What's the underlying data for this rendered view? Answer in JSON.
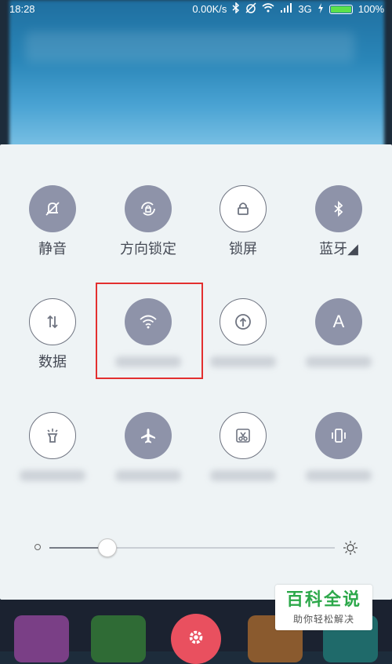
{
  "status_bar": {
    "time": "18:28",
    "net_speed": "0.00K/s",
    "network_type": "3G",
    "battery": "100%",
    "icons": [
      "bluetooth-icon",
      "alarm-off-icon",
      "wifi-icon",
      "signal-icon",
      "charging-icon",
      "battery-icon"
    ]
  },
  "quick_settings": {
    "row1": [
      {
        "label": "静音",
        "icon": "bell-off-icon",
        "state": "on"
      },
      {
        "label": "方向锁定",
        "icon": "rotation-lock-icon",
        "state": "on"
      },
      {
        "label": "锁屏",
        "icon": "lock-icon",
        "state": "off"
      },
      {
        "label": "蓝牙◢",
        "icon": "bluetooth-icon",
        "state": "on"
      }
    ],
    "row2": [
      {
        "label": "数据",
        "icon": "data-arrows-icon",
        "state": "off"
      },
      {
        "label": "",
        "icon": "wifi-icon",
        "state": "on"
      },
      {
        "label": "",
        "icon": "upload-icon",
        "state": "off"
      },
      {
        "label": "",
        "icon": "auto-brightness-icon",
        "state": "on",
        "glyph": "A"
      }
    ],
    "row3": [
      {
        "label": "",
        "icon": "flashlight-icon",
        "state": "off"
      },
      {
        "label": "",
        "icon": "airplane-icon",
        "state": "on"
      },
      {
        "label": "",
        "icon": "screenshot-icon",
        "state": "off"
      },
      {
        "label": "",
        "icon": "vibrate-icon",
        "state": "on"
      }
    ]
  },
  "brightness": {
    "level": 0.2,
    "low_icon": "brightness-low-icon",
    "high_icon": "brightness-high-icon"
  },
  "watermark": {
    "title": "百科全说",
    "subtitle": "助你轻松解决"
  },
  "colors": {
    "tile_on": "#8e93a9",
    "panel": "#eef3f5",
    "highlight_box": "#e32f2f",
    "watermark_green": "#2ca84a"
  }
}
